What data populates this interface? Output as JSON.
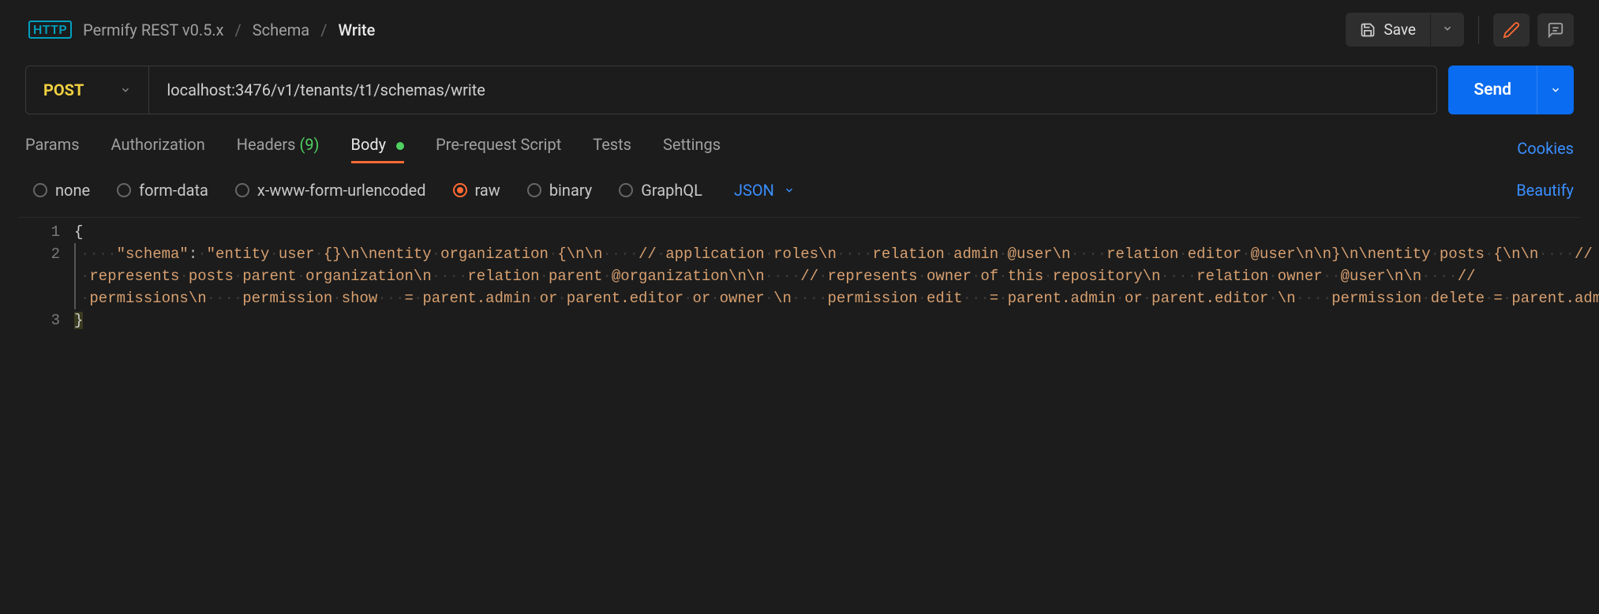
{
  "breadcrumb": {
    "badge": "HTTP",
    "collection": "Permify REST v0.5.x",
    "folder": "Schema",
    "item": "Write"
  },
  "toolbar": {
    "save_label": "Save"
  },
  "request": {
    "method": "POST",
    "url": "localhost:3476/v1/tenants/t1/schemas/write",
    "send_label": "Send"
  },
  "tabs": {
    "params": "Params",
    "authorization": "Authorization",
    "headers": "Headers",
    "headers_count": "(9)",
    "body": "Body",
    "prerequest": "Pre-request Script",
    "tests": "Tests",
    "settings": "Settings",
    "cookies": "Cookies"
  },
  "body_types": {
    "none": "none",
    "formdata": "form-data",
    "urlencoded": "x-www-form-urlencoded",
    "raw": "raw",
    "binary": "binary",
    "graphql": "GraphQL",
    "content_type": "JSON",
    "beautify": "Beautify"
  },
  "editor": {
    "line1_num": "1",
    "line2_num": "2",
    "line3_num": "3",
    "line1": "{",
    "key": "\"schema\"",
    "value": "\"entity user {}\\n\\nentity organization {\\n\\n    // application roles\\n    relation admin @user\\n    relation editor @user\\n\\n}\\n\\nentity posts {\\n\\n    // represents posts parent organization\\n    relation parent @organization\\n\\n    // represents owner of this repository\\n    relation owner  @user\\n\\n    // permissions\\n    permission show   = parent.admin or parent.editor or owner \\n    permission edit   = parent.admin or parent.editor \\n    permission delete = parent.admin\\n}\"",
    "line3": "}"
  }
}
